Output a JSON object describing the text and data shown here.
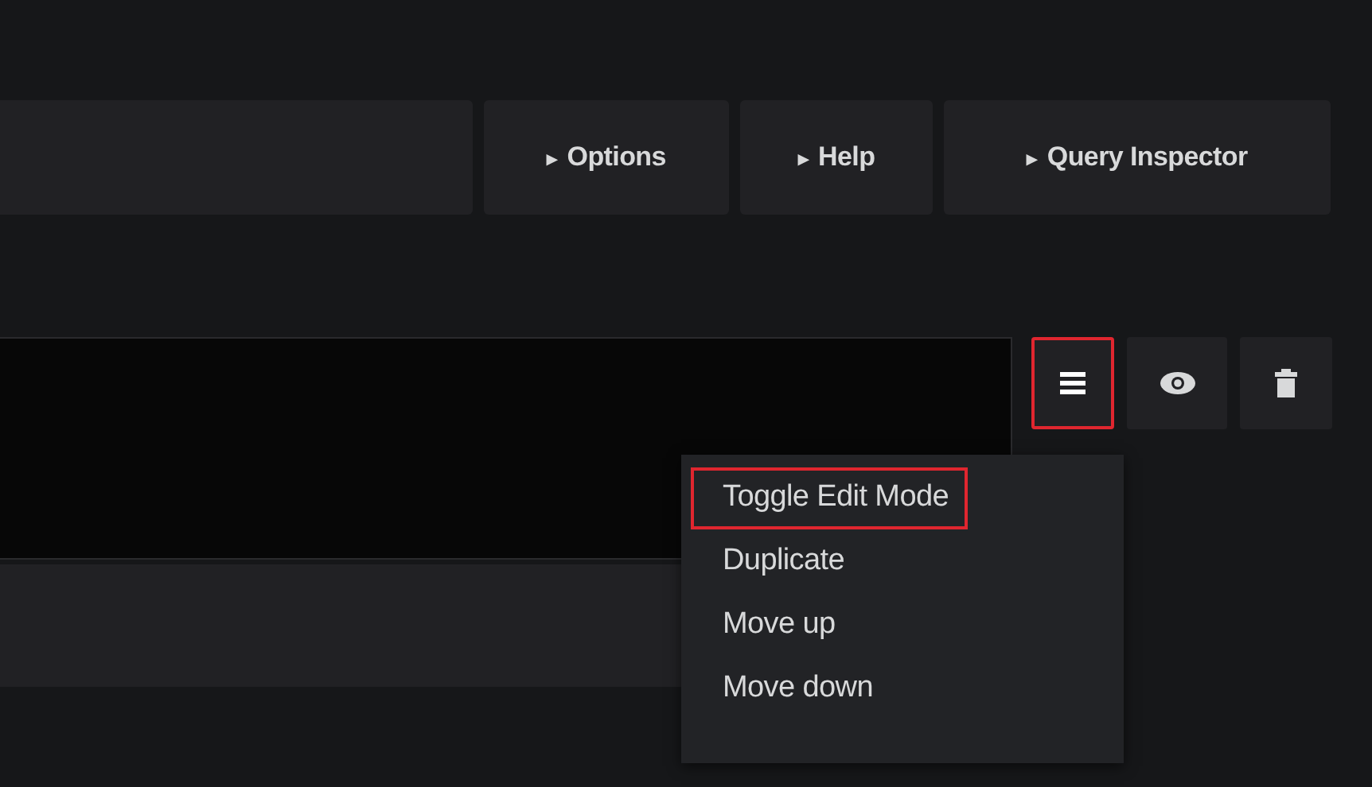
{
  "toolbar_buttons": [
    {
      "label": "Options",
      "caret": "▸"
    },
    {
      "label": "Help",
      "caret": "▸"
    },
    {
      "label": "Query Inspector",
      "caret": "▸"
    }
  ],
  "query_actions": [
    {
      "kind": "menu",
      "highlighted": true
    },
    {
      "kind": "eye",
      "highlighted": false
    },
    {
      "kind": "trash",
      "highlighted": false
    }
  ],
  "menu": {
    "items": [
      {
        "label": "Toggle Edit Mode",
        "highlighted": true
      },
      {
        "label": "Duplicate",
        "highlighted": false
      },
      {
        "label": "Move up",
        "highlighted": false
      },
      {
        "label": "Move down",
        "highlighted": false
      }
    ]
  }
}
